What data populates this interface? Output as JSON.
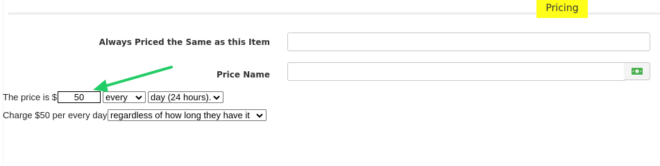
{
  "section": {
    "title": "Pricing"
  },
  "fields": {
    "always_priced_label": "Always Priced the Same as this Item",
    "always_priced_value": "",
    "price_name_label": "Price Name",
    "price_name_value": "",
    "money_icon": "money-bill-icon"
  },
  "price_rule": {
    "prefix": "The price is $",
    "amount": "50",
    "every_select": "every",
    "period_select": "day (24 hours)."
  },
  "charge_rule": {
    "text": "Charge $50 per every day",
    "duration_select": "regardless of how long they have it"
  },
  "colors": {
    "highlight": "#ffff1a",
    "arrow": "#22cc66",
    "money_icon": "#4caf50"
  },
  "annotations": {
    "arrow": "green-arrow-pointing-to-price-input"
  }
}
